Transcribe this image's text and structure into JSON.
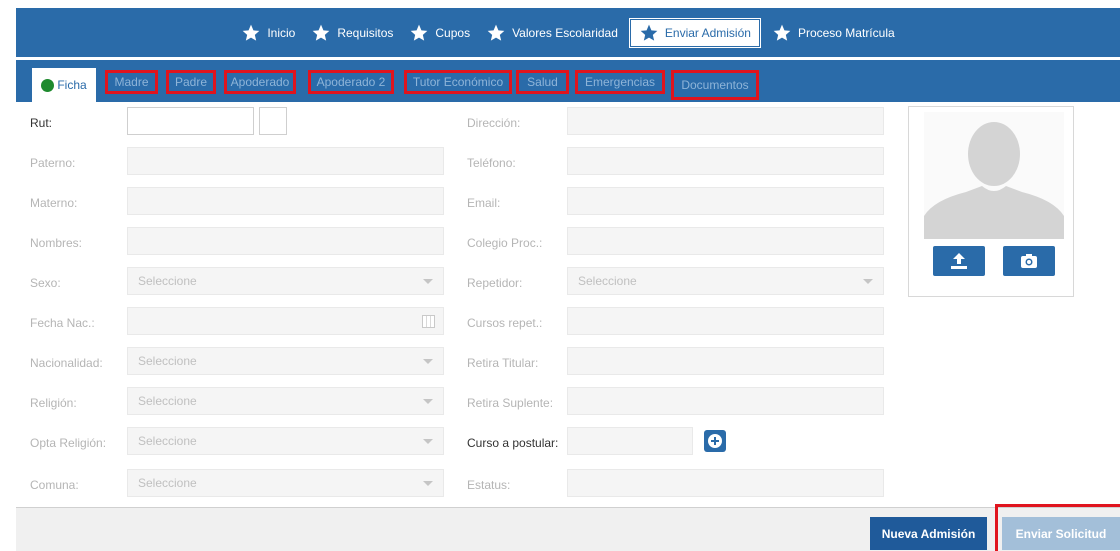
{
  "nav": {
    "items": [
      {
        "label": "Inicio",
        "active": false
      },
      {
        "label": "Requisitos",
        "active": false
      },
      {
        "label": "Cupos",
        "active": false
      },
      {
        "label": "Valores Escolaridad",
        "active": false
      },
      {
        "label": "Enviar Admisión",
        "active": true
      },
      {
        "label": "Proceso Matrícula",
        "active": false
      }
    ]
  },
  "tabs": [
    {
      "label": "Ficha"
    },
    {
      "label": "Madre"
    },
    {
      "label": "Padre"
    },
    {
      "label": "Apoderado"
    },
    {
      "label": "Apoderado 2"
    },
    {
      "label": "Tutor Económico"
    },
    {
      "label": "Salud"
    },
    {
      "label": "Emergencias"
    },
    {
      "label": "Documentos"
    }
  ],
  "form": {
    "left": {
      "rut": "Rut:",
      "paterno": "Paterno:",
      "materno": "Materno:",
      "nombres": "Nombres:",
      "sexo": "Sexo:",
      "fecha_nac": "Fecha Nac.:",
      "nacionalidad": "Nacionalidad:",
      "religion": "Religión:",
      "opta_religion": "Opta Religión:",
      "comuna": "Comuna:"
    },
    "right": {
      "direccion": "Dirección:",
      "telefono": "Teléfono:",
      "email": "Email:",
      "colegio_proc": "Colegio Proc.:",
      "repetidor": "Repetidor:",
      "cursos_repet": "Cursos repet.:",
      "retira_titular": "Retira Titular:",
      "retira_suplente": "Retira Suplente:",
      "curso_postular": "Curso a postular:",
      "estatus": "Estatus:"
    },
    "select_placeholder": "Seleccione"
  },
  "footer": {
    "nueva_admision": "Nueva Admisión",
    "enviar_solicitud": "Enviar Solicitud"
  },
  "colors": {
    "primary": "#2a6ba9",
    "highlight": "#e0141e",
    "leaf": "#1e8a2e"
  }
}
